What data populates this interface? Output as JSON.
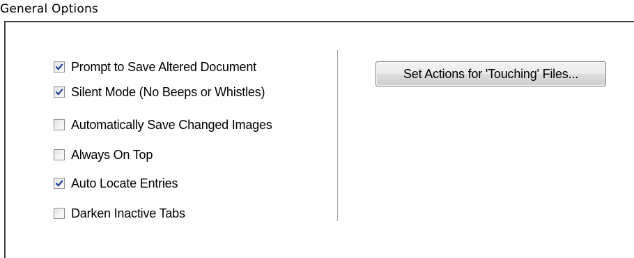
{
  "section": {
    "title": "General Options"
  },
  "options": [
    {
      "label": "Prompt to Save Altered Document",
      "checked": true
    },
    {
      "label": "Silent Mode (No Beeps or Whistles)",
      "checked": true
    },
    {
      "label": "Automatically Save Changed Images",
      "checked": false
    },
    {
      "label": "Always On Top",
      "checked": false
    },
    {
      "label": "Auto Locate Entries",
      "checked": true
    },
    {
      "label": "Darken Inactive Tabs",
      "checked": false
    }
  ],
  "actions": {
    "touching_files_button": "Set Actions for 'Touching' Files..."
  },
  "colors": {
    "check_mark": "#1d3f99",
    "divider": "#a0a0a0",
    "group_border": "#404040"
  }
}
